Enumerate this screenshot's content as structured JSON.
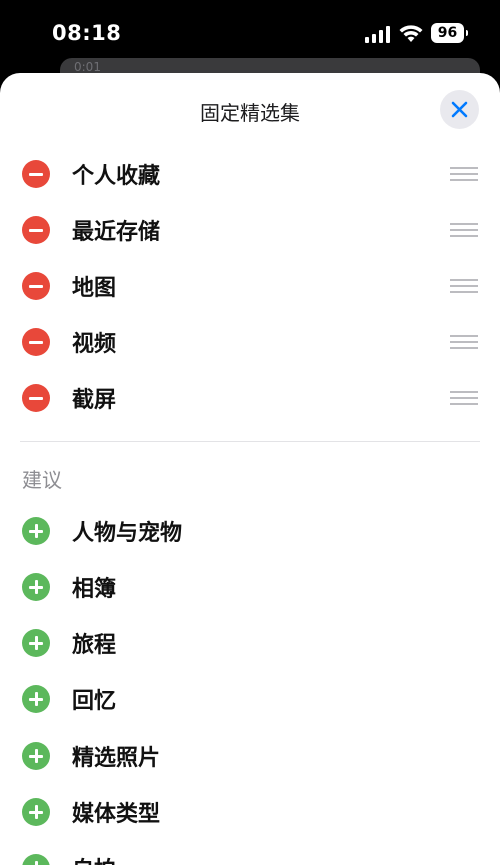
{
  "status_bar": {
    "time": "08:18",
    "battery": "96"
  },
  "background": {
    "snippet": "0:01"
  },
  "sheet": {
    "title": "固定精选集",
    "close_icon": "close-icon"
  },
  "pinned": [
    {
      "label": "个人收藏"
    },
    {
      "label": "最近存储"
    },
    {
      "label": "地图"
    },
    {
      "label": "视频"
    },
    {
      "label": "截屏"
    }
  ],
  "suggestions": {
    "header": "建议",
    "items": [
      {
        "label": "人物与宠物"
      },
      {
        "label": "相簿"
      },
      {
        "label": "旅程"
      },
      {
        "label": "回忆"
      },
      {
        "label": "精选照片"
      },
      {
        "label": "媒体类型"
      },
      {
        "label": "自拍"
      }
    ]
  },
  "colors": {
    "remove": "#e8483a",
    "add": "#5cb85c",
    "accent": "#007aff"
  }
}
